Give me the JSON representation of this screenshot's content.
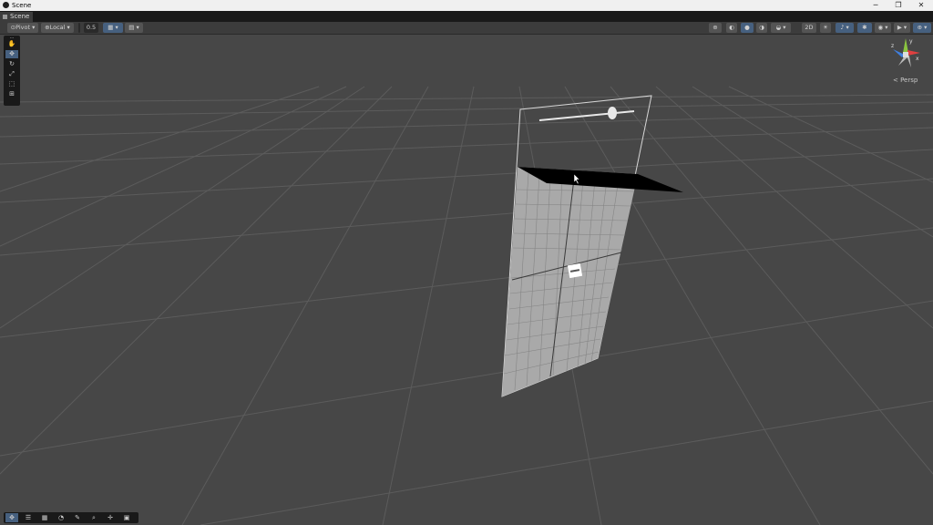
{
  "window": {
    "title": "Scene",
    "controls": [
      "─",
      "❐",
      "✕"
    ]
  },
  "tab": {
    "label": "Scene"
  },
  "toolbar": {
    "pivot_label": "Pivot",
    "local_label": "Local",
    "snap_value": "0.5",
    "mode_2d_label": "2D"
  },
  "tool_palette": {
    "tools": [
      "hand-tool",
      "move-tool",
      "rotate-tool",
      "scale-tool",
      "rect-tool",
      "transform-tool"
    ],
    "active_tool": "move-tool"
  },
  "gizmo": {
    "axis_x": "x",
    "axis_y": "y",
    "axis_z": "z",
    "projection_label": "< Persp"
  },
  "bottom_toolbar": {
    "buttons": [
      "move-icon",
      "layout-icon",
      "grid-icon",
      "rotate-icon",
      "brush-icon",
      "search-icon",
      "transform-icon",
      "image-icon"
    ]
  },
  "colors": {
    "background": "#474747",
    "accent": "#46607f",
    "panel": "#3c3c3c",
    "gizmo_x": "#e04040",
    "gizmo_y": "#8ac440",
    "gizmo_z": "#3f7fe0"
  }
}
